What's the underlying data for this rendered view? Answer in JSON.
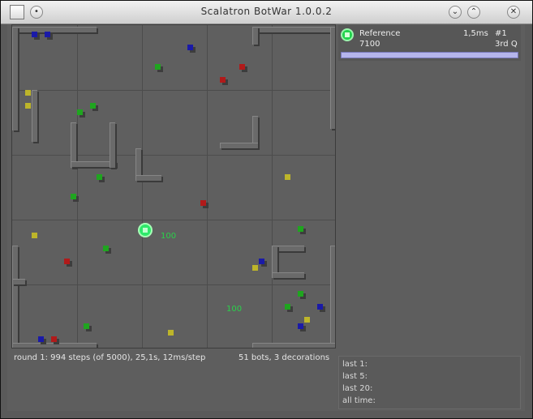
{
  "window": {
    "title": "Scalatron BotWar 1.0.0.2",
    "controls": {
      "minimize": "⌄",
      "maximize": "⌃",
      "close": "✕",
      "menu": "•"
    }
  },
  "arena": {
    "energy_labels": [
      "100",
      "100"
    ]
  },
  "status": {
    "left": "round 1: 994 steps (of 5000), 25,1s, 12ms/step",
    "right": "51 bots, 3 decorations"
  },
  "scoreboard": {
    "name": "Reference",
    "score": "7100",
    "time": "1,5ms",
    "rank": "#1",
    "place": "3rd Q",
    "progress": 1.0
  },
  "stats": {
    "last1": "last 1:",
    "last5": "last 5:",
    "last20": "last 20:",
    "alltime": "all time:"
  },
  "colors": {
    "bot": "#1fa51f",
    "enemy": "#b11a1a",
    "fluppet": "#1a1aa8",
    "food": "#bdb52a",
    "master": "#2ee86a",
    "bar": "#b5b5ec"
  }
}
